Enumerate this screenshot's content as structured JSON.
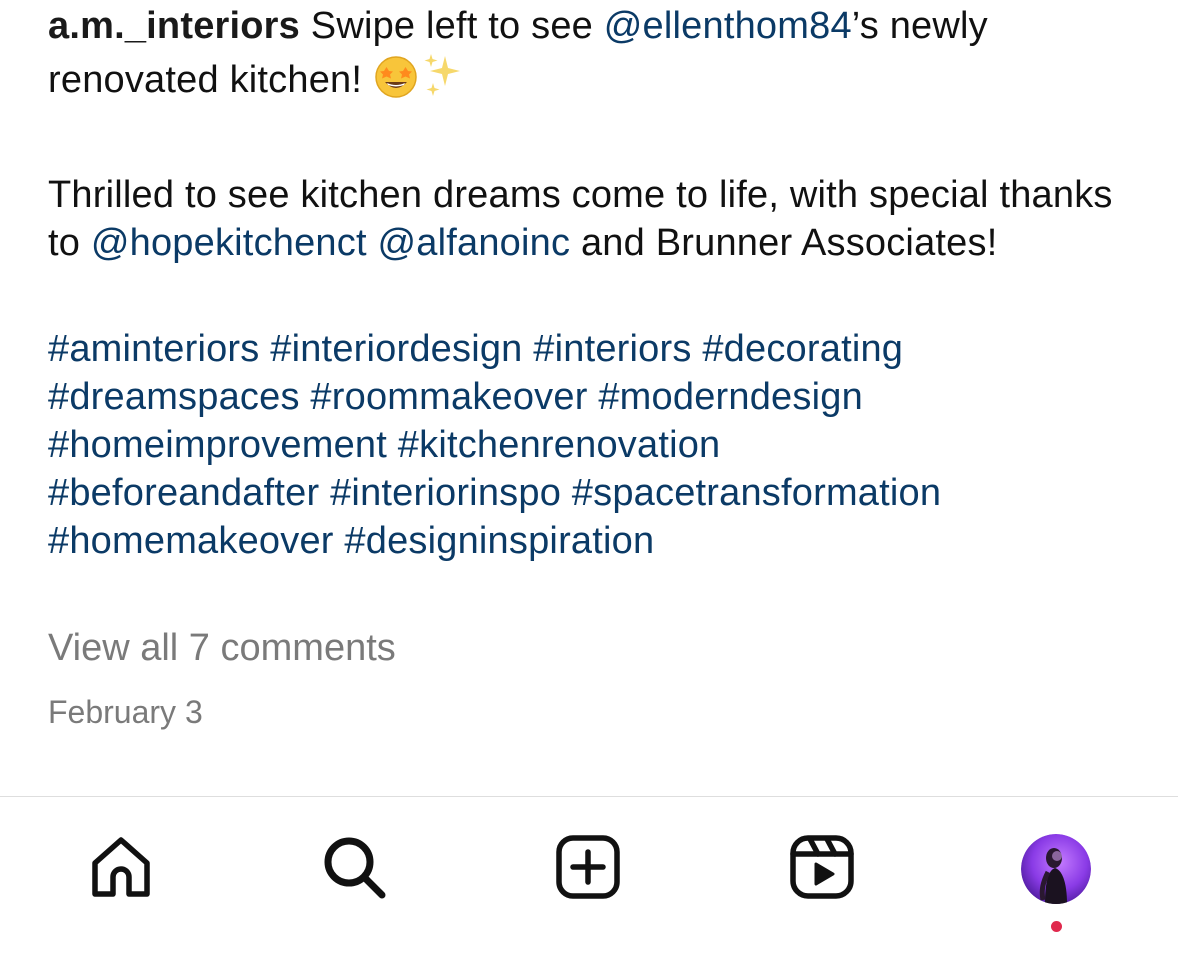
{
  "post": {
    "username": "a.m._interiors",
    "caption_line1_text": " Swipe left to see ",
    "mention_ellen": "@ellenthom84",
    "caption_line1_suffix": "’s newly",
    "caption_line2_text": "renovated kitchen! ",
    "emoji_star_struck": "star-struck-emoji",
    "emoji_sparkles": "sparkles-emoji",
    "para2_text": "Thrilled to see kitchen dreams come to life, with special thanks to ",
    "mention_hope": "@hopekitchenct",
    "para2_space": " ",
    "mention_alfano": "@alfanoinc",
    "para2_end": " and Brunner Associates!",
    "hashtags": [
      "#aminteriors",
      "#interiordesign",
      "#interiors",
      "#decorating",
      "#dreamspaces",
      "#roommakeover",
      "#moderndesign",
      "#homeimprovement",
      "#kitchenrenovation",
      "#beforeandafter",
      "#interiorinspo",
      "#spacetransformation",
      "#homemakeover",
      "#designinspiration"
    ],
    "view_comments": "View all 7 comments",
    "date": "February 3"
  },
  "tabbar": {
    "items": [
      {
        "icon": "home-icon"
      },
      {
        "icon": "search-icon"
      },
      {
        "icon": "create-post-icon"
      },
      {
        "icon": "reels-icon"
      },
      {
        "icon": "profile-avatar"
      }
    ],
    "notification_dot_color": "#e0294d"
  },
  "colors": {
    "link": "#0b3a66",
    "muted": "#7a7a7a",
    "text": "#111111"
  }
}
